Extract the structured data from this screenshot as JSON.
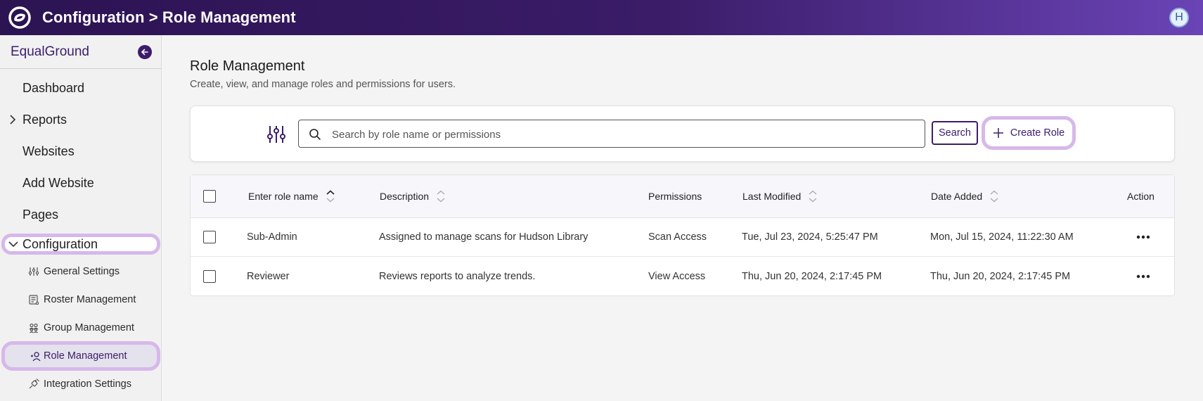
{
  "app": {
    "title": "Configuration > Role Management",
    "user_initial": "H",
    "brand_color": "#3b1d6b",
    "highlight_color": "#d7b8ea"
  },
  "sidebar": {
    "brand": "EqualGround",
    "nav": [
      {
        "label": "Dashboard"
      },
      {
        "label": "Reports",
        "expandable": true
      },
      {
        "label": "Websites"
      },
      {
        "label": "Add Website"
      },
      {
        "label": "Pages"
      },
      {
        "label": "Configuration",
        "expanded": true
      }
    ],
    "config_items": [
      {
        "label": "General Settings",
        "icon": "sliders-icon"
      },
      {
        "label": "Roster Management",
        "icon": "roster-icon"
      },
      {
        "label": "Group Management",
        "icon": "group-icon"
      },
      {
        "label": "Role Management",
        "icon": "role-icon",
        "active": true
      },
      {
        "label": "Integration Settings",
        "icon": "plug-icon"
      }
    ]
  },
  "page": {
    "title": "Role Management",
    "subtitle": "Create, view, and manage roles and permissions for users."
  },
  "search": {
    "placeholder": "Search by role name or permissions",
    "value": "",
    "button_label": "Search",
    "create_label": "Create Role"
  },
  "table": {
    "columns": {
      "name": "Enter role name",
      "description": "Description",
      "permissions": "Permissions",
      "last_modified": "Last Modified",
      "date_added": "Date Added",
      "action": "Action"
    },
    "rows": [
      {
        "name": "Sub-Admin",
        "description": "Assigned to manage scans for Hudson Library",
        "permissions": "Scan Access",
        "last_modified": "Tue, Jul 23, 2024, 5:25:47 PM",
        "date_added": "Mon, Jul 15, 2024, 11:22:30 AM"
      },
      {
        "name": "Reviewer",
        "description": "Reviews reports to analyze trends.",
        "permissions": "View Access",
        "last_modified": "Thu, Jun 20, 2024, 2:17:45 PM",
        "date_added": "Thu, Jun 20, 2024, 2:17:45 PM"
      }
    ]
  }
}
